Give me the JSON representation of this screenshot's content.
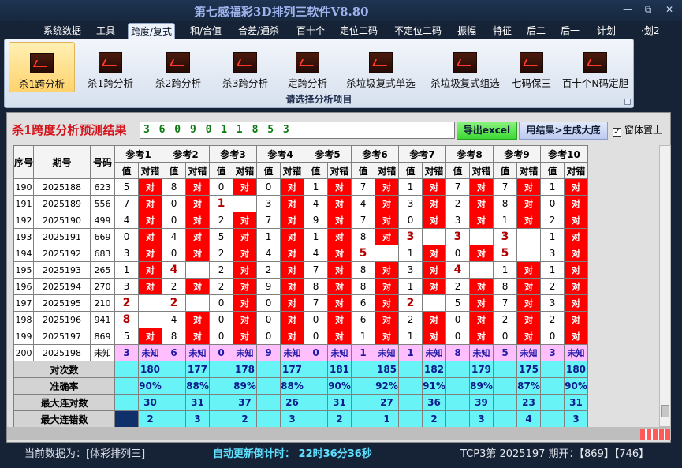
{
  "window": {
    "title": "第七感福彩3D排列三软件V8.80",
    "min": "—",
    "max": "⧉",
    "close": "✕"
  },
  "menu": [
    "系统数据",
    "工具",
    "跨度/复式",
    "和/合值",
    "合差/通杀",
    "百十个",
    "定位二码",
    "不定位二码",
    "振幅",
    "特征",
    "后二",
    "后一",
    "计划",
    "·划2"
  ],
  "menu_active": 2,
  "ribbon": {
    "buttons": [
      "杀1跨分析",
      "杀1跨分析",
      "杀2跨分析",
      "杀3跨分析",
      "定跨分析",
      "杀垃圾复式单选",
      "杀垃圾复式组选",
      "七码保三",
      "百十个N码定胆"
    ],
    "selected": 0,
    "caption": "请选择分析项目"
  },
  "panel": {
    "title": "杀1跨度分析预测结果",
    "result": "3 6 0 9 0 1 1 8 5 3",
    "export_label": "导出excel",
    "generate_label": "用结果>生成大底",
    "topmost_label": "窗体置上",
    "topmost_checked": "✓"
  },
  "table": {
    "h_seq": "序号",
    "h_period": "期号",
    "h_num": "号码",
    "refs": [
      "参考1",
      "参考2",
      "参考3",
      "参考4",
      "参考5",
      "参考6",
      "参考7",
      "参考8",
      "参考9",
      "参考10"
    ],
    "sub_val": "值",
    "sub_ok": "对错",
    "ok_text": "对",
    "unknown": "未知",
    "rows": [
      {
        "seq": "190",
        "period": "2025188",
        "num": "623",
        "vals": [
          "5",
          "8",
          "0",
          "0",
          "1",
          "7",
          "1",
          "7",
          "7",
          "1"
        ],
        "ok": [
          1,
          1,
          1,
          1,
          1,
          1,
          1,
          1,
          1,
          1
        ]
      },
      {
        "seq": "191",
        "period": "2025189",
        "num": "556",
        "vals": [
          "7",
          "0",
          "1",
          "3",
          "4",
          "4",
          "3",
          "2",
          "8",
          "0"
        ],
        "ok": [
          1,
          1,
          0,
          1,
          1,
          1,
          1,
          1,
          1,
          1
        ]
      },
      {
        "seq": "192",
        "period": "2025190",
        "num": "499",
        "vals": [
          "4",
          "0",
          "2",
          "7",
          "9",
          "7",
          "0",
          "3",
          "1",
          "2"
        ],
        "ok": [
          1,
          1,
          1,
          1,
          1,
          1,
          1,
          1,
          1,
          1
        ]
      },
      {
        "seq": "193",
        "period": "2025191",
        "num": "669",
        "vals": [
          "0",
          "4",
          "5",
          "1",
          "1",
          "8",
          "3",
          "3",
          "3",
          "1"
        ],
        "ok": [
          1,
          1,
          1,
          1,
          1,
          1,
          0,
          0,
          0,
          1
        ]
      },
      {
        "seq": "194",
        "period": "2025192",
        "num": "683",
        "vals": [
          "3",
          "0",
          "2",
          "4",
          "4",
          "5",
          "1",
          "0",
          "5",
          "3"
        ],
        "ok": [
          1,
          1,
          1,
          1,
          1,
          0,
          1,
          1,
          0,
          1
        ]
      },
      {
        "seq": "195",
        "period": "2025193",
        "num": "265",
        "vals": [
          "1",
          "4",
          "2",
          "2",
          "7",
          "8",
          "3",
          "4",
          "1",
          "1"
        ],
        "ok": [
          1,
          0,
          1,
          1,
          1,
          1,
          1,
          0,
          1,
          1
        ]
      },
      {
        "seq": "196",
        "period": "2025194",
        "num": "270",
        "vals": [
          "3",
          "2",
          "2",
          "9",
          "8",
          "8",
          "1",
          "2",
          "8",
          "2"
        ],
        "ok": [
          1,
          1,
          1,
          1,
          1,
          1,
          1,
          1,
          1,
          1
        ]
      },
      {
        "seq": "197",
        "period": "2025195",
        "num": "210",
        "vals": [
          "2",
          "2",
          "0",
          "0",
          "7",
          "6",
          "2",
          "5",
          "7",
          "3"
        ],
        "ok": [
          0,
          0,
          1,
          1,
          1,
          1,
          0,
          1,
          1,
          1
        ]
      },
      {
        "seq": "198",
        "period": "2025196",
        "num": "941",
        "vals": [
          "8",
          "4",
          "0",
          "0",
          "0",
          "6",
          "2",
          "0",
          "2",
          "2"
        ],
        "ok": [
          0,
          1,
          1,
          1,
          1,
          1,
          1,
          1,
          1,
          1
        ]
      },
      {
        "seq": "199",
        "period": "2025197",
        "num": "869",
        "vals": [
          "5",
          "8",
          "0",
          "0",
          "0",
          "1",
          "1",
          "0",
          "0",
          "0"
        ],
        "ok": [
          1,
          1,
          1,
          1,
          1,
          1,
          1,
          1,
          1,
          1
        ]
      }
    ],
    "big": [
      [],
      [
        2
      ],
      [],
      [
        6,
        7,
        8
      ],
      [
        5,
        8
      ],
      [
        1,
        7
      ],
      [],
      [
        0,
        1,
        6
      ],
      [
        0
      ],
      []
    ],
    "predict": {
      "seq": "200",
      "period": "2025198",
      "num": "未知",
      "vals": [
        "3",
        "6",
        "0",
        "9",
        "0",
        "1",
        "1",
        "8",
        "5",
        "3"
      ]
    },
    "stats": [
      {
        "label": "对次数",
        "vals": [
          "180",
          "177",
          "178",
          "177",
          "181",
          "185",
          "182",
          "179",
          "175",
          "180"
        ]
      },
      {
        "label": "准确率",
        "vals": [
          "90%",
          "88%",
          "89%",
          "88%",
          "90%",
          "92%",
          "91%",
          "89%",
          "87%",
          "90%"
        ]
      },
      {
        "label": "最大连对数",
        "vals": [
          "30",
          "31",
          "37",
          "26",
          "31",
          "27",
          "36",
          "39",
          "23",
          "31"
        ]
      },
      {
        "label": "最大连错数",
        "vals": [
          "2",
          "3",
          "2",
          "3",
          "2",
          "1",
          "2",
          "3",
          "4",
          "3"
        ]
      }
    ]
  },
  "status": {
    "data_source": "当前数据为：[体彩排列三]",
    "countdown": "自动更新倒计时： 22时36分36秒",
    "tcp": "TCP3第 2025197 期开：【869】【746】"
  }
}
